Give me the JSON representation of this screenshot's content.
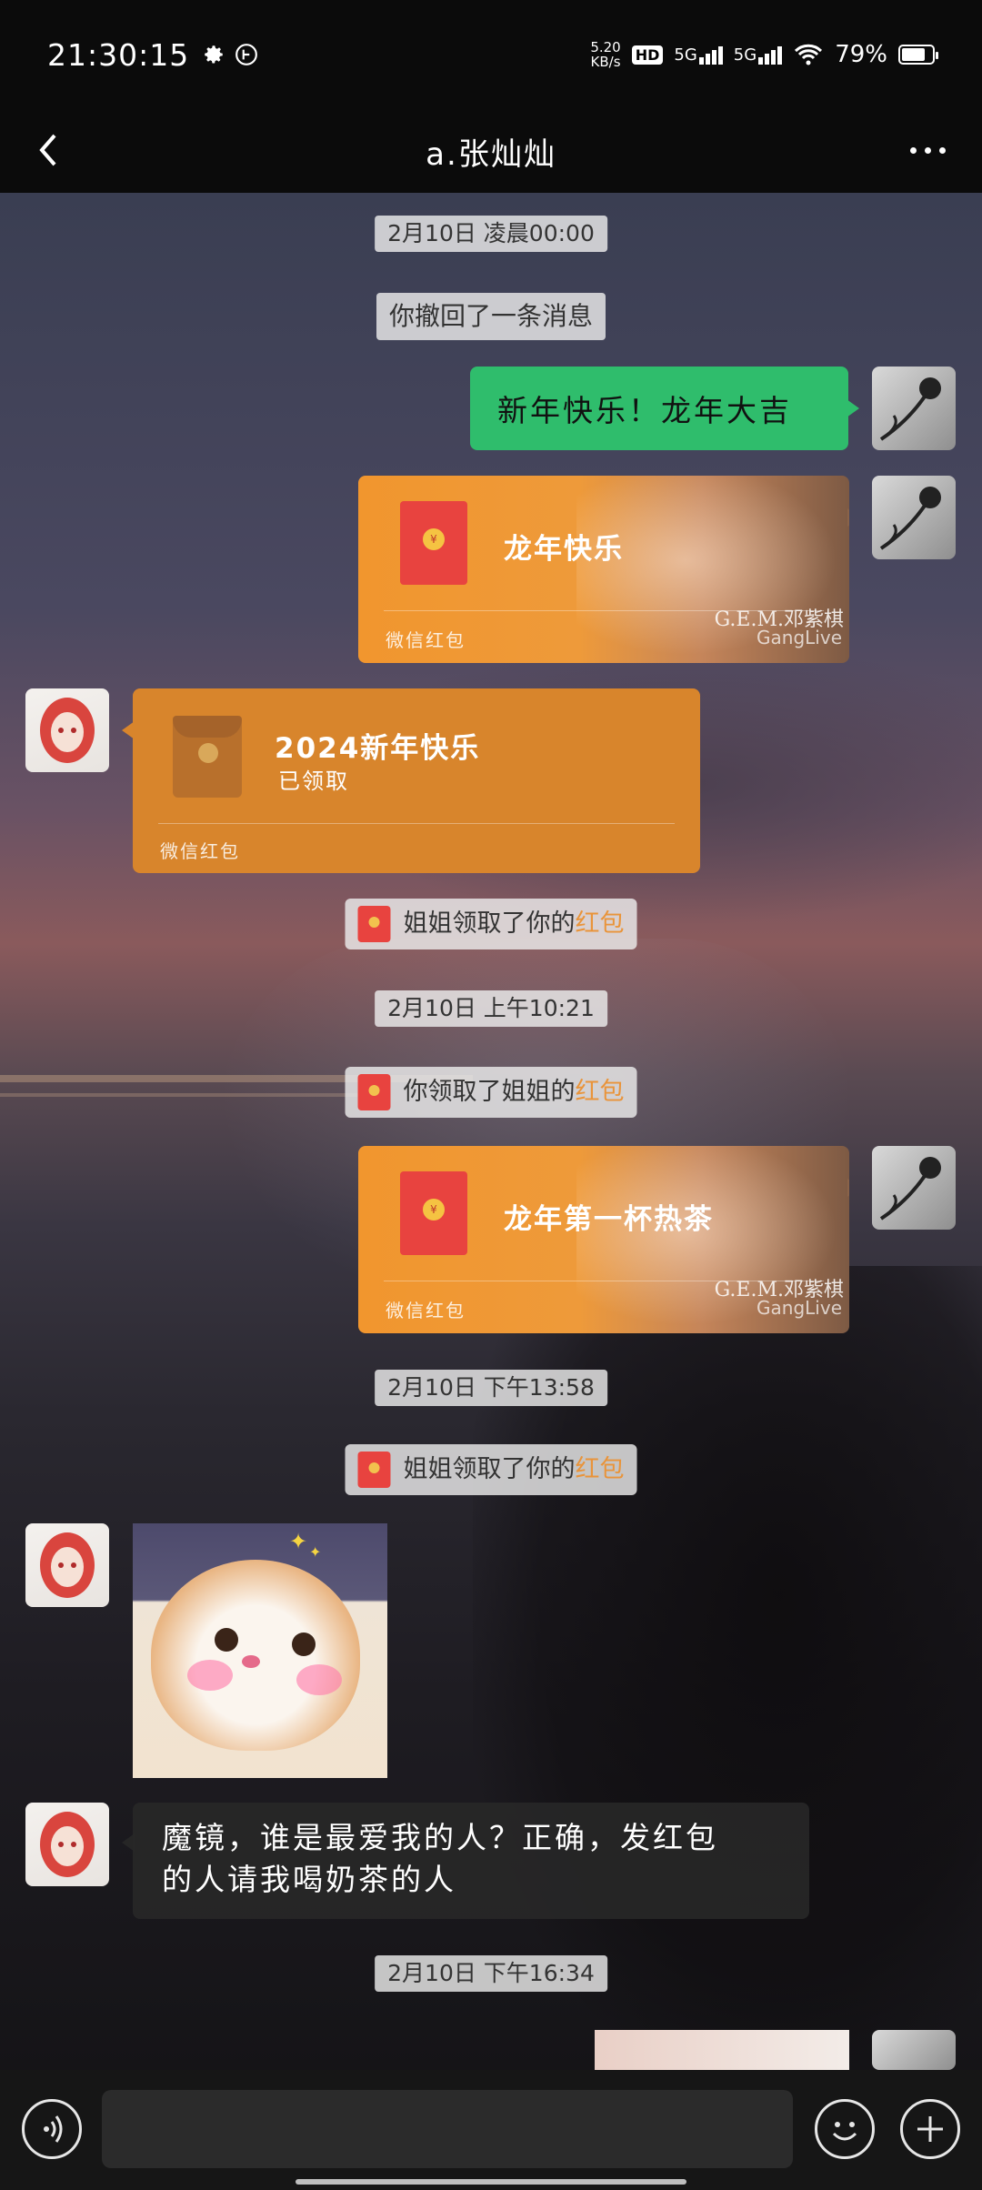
{
  "status_bar": {
    "time": "21:30:15",
    "net_speed_value": "5.20",
    "net_speed_unit": "KB/s",
    "hd_label": "HD",
    "net1": "5G",
    "net2": "5G",
    "battery": "79%",
    "icons": [
      "gear-icon",
      "nfc-icon",
      "hd-icon",
      "signal-icon",
      "wifi-icon",
      "battery-icon"
    ]
  },
  "header": {
    "title": "a.张灿灿",
    "back_icon": "chevron-left-icon",
    "more_icon": "more-dots-icon"
  },
  "messages": {
    "ts1": "2月10日 凌晨00:00",
    "recall": "你撤回了一条消息",
    "text1": "新年快乐！龙年大吉",
    "hb1_title": "龙年快乐",
    "hb1_footer": "微信红包",
    "hb1_brand": "G.E.M.邓紫棋",
    "hb1_brand_sub": "GangLive",
    "hb2_title": "2024新年快乐",
    "hb2_status": "已领取",
    "hb2_footer": "微信红包",
    "note1_prefix": "姐姐领取了你的",
    "note1_link": "红包",
    "ts2": "2月10日 上午10:21",
    "note2_prefix": "你领取了姐姐的",
    "note2_link": "红包",
    "hb3_title": "龙年第一杯热茶",
    "hb3_footer": "微信红包",
    "hb3_brand": "G.E.M.邓紫棋",
    "hb3_brand_sub": "GangLive",
    "ts3": "2月10日 下午13:58",
    "note3_prefix": "姐姐领取了你的",
    "note3_link": "红包",
    "text2_line1": "魔镜，谁是最爱我的人？正确，发红包",
    "text2_line2": "的人请我喝奶茶的人",
    "ts4": "2月10日 下午16:34"
  },
  "input_bar": {
    "placeholder": "",
    "voice_icon": "voice-icon",
    "emoji_icon": "emoji-icon",
    "plus_icon": "plus-icon"
  },
  "colors": {
    "accent_green": "#2fbd6c",
    "hongbao_orange": "#f1962e",
    "hongbao_red": "#e8433f",
    "highlight": "#e9943a"
  }
}
